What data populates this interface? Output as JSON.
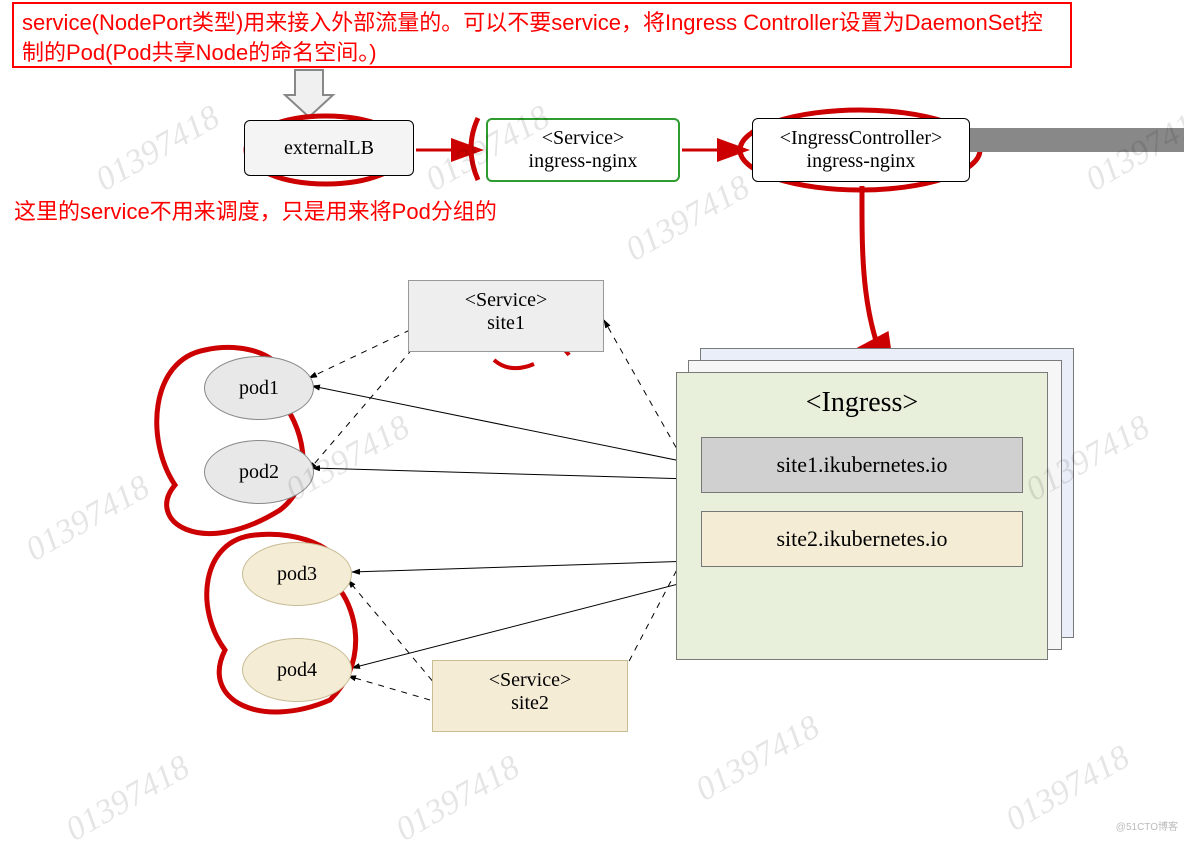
{
  "topNote": "service(NodePort类型)用来接入外部流量的。可以不要service，将Ingress Controller设置为DaemonSet控制的Pod(Pod共享Node的命名空间。)",
  "externalLB": "externalLB",
  "serviceNginx": {
    "line1": "<Service>",
    "line2": "ingress-nginx"
  },
  "ingressCtrl": {
    "line1": "<IngressController>",
    "line2": "ingress-nginx"
  },
  "groupNote": "这里的service不用来调度，只是用来将Pod分组的",
  "svcSite1": {
    "line1": "<Service>",
    "line2": "site1"
  },
  "svcSite2": {
    "line1": "<Service>",
    "line2": "site2"
  },
  "pods": {
    "p1": "pod1",
    "p2": "pod2",
    "p3": "pod3",
    "p4": "pod4"
  },
  "ingress": {
    "title": "<Ingress>",
    "site1": "site1.ikubernetes.io",
    "site2": "site2.ikubernetes.io"
  },
  "watermarkNumber": "01397418",
  "footerWatermark": "@51CTO博客"
}
